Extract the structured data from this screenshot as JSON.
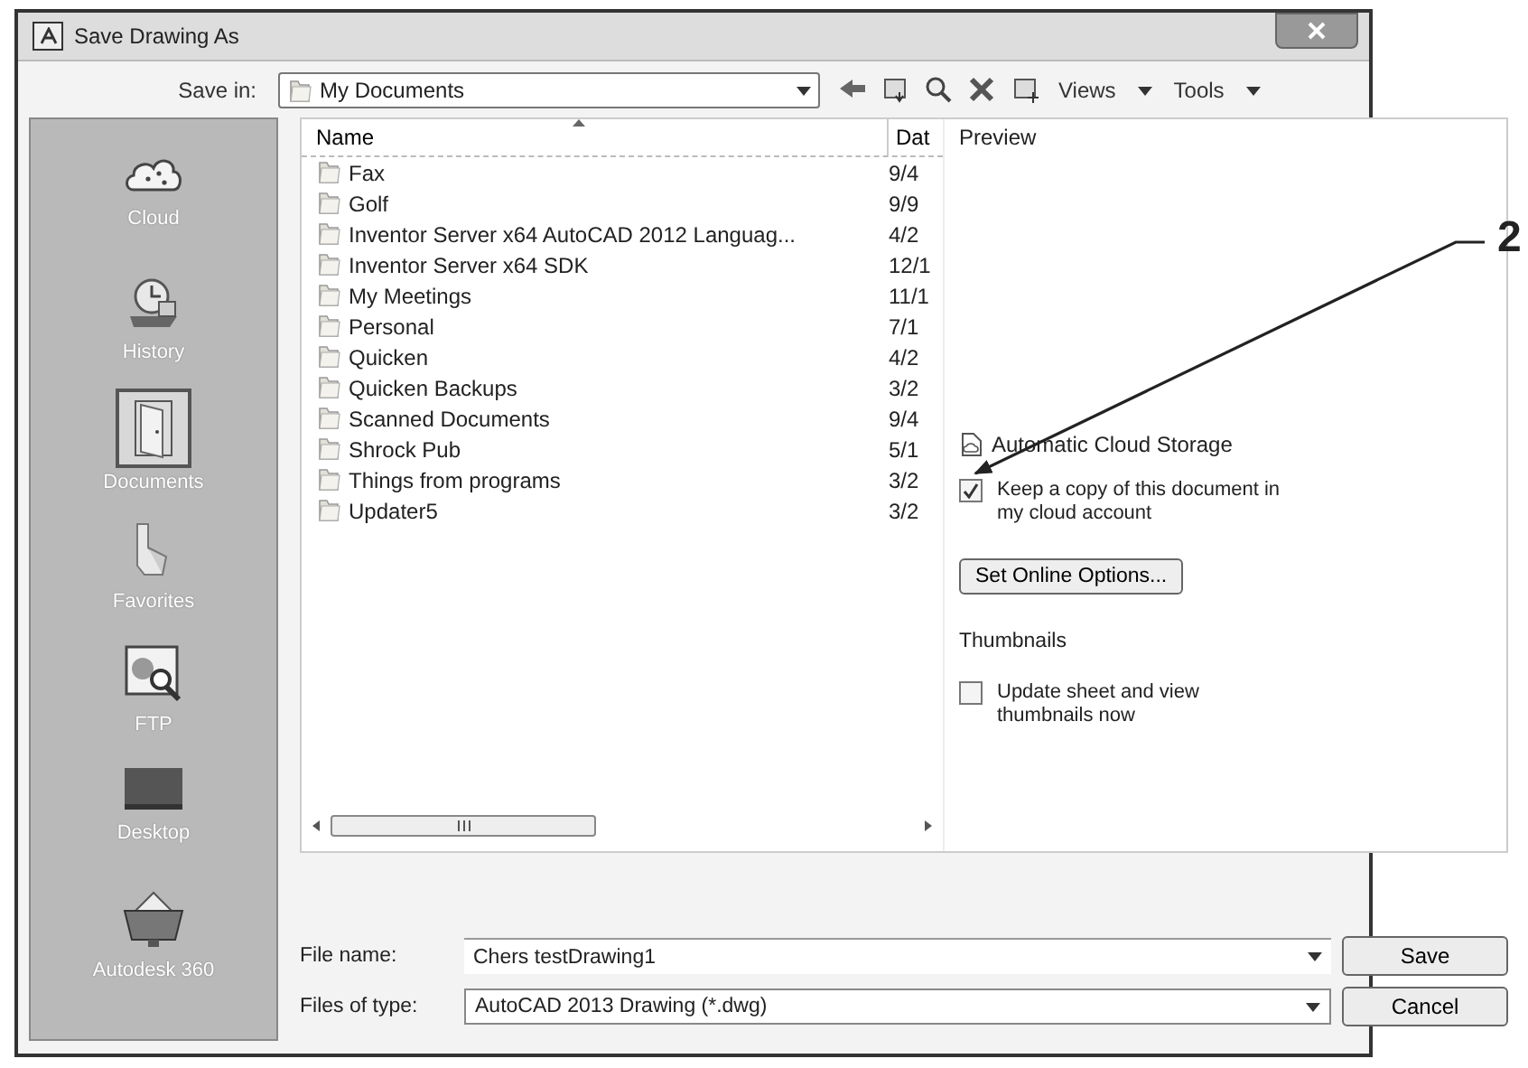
{
  "window": {
    "title": "Save Drawing As"
  },
  "toolbar": {
    "save_in_label": "Save in:",
    "save_in_value": "My Documents",
    "menus": [
      "Views",
      "Tools"
    ]
  },
  "places": [
    {
      "label": "Cloud",
      "kind": "cloud",
      "selected": false
    },
    {
      "label": "History",
      "kind": "history",
      "selected": false
    },
    {
      "label": "Documents",
      "kind": "documents",
      "selected": true
    },
    {
      "label": "Favorites",
      "kind": "favorites",
      "selected": false
    },
    {
      "label": "FTP",
      "kind": "ftp",
      "selected": false
    },
    {
      "label": "Desktop",
      "kind": "desktop",
      "selected": false
    },
    {
      "label": "Autodesk 360",
      "kind": "cloud360",
      "selected": false
    }
  ],
  "file_list": {
    "columns": [
      "Name",
      "Dat"
    ],
    "rows": [
      {
        "name": "Fax",
        "date": "9/4"
      },
      {
        "name": "Golf",
        "date": "9/9"
      },
      {
        "name": "Inventor Server x64 AutoCAD 2012 Languag...",
        "date": "4/2"
      },
      {
        "name": "Inventor Server x64 SDK",
        "date": "12/1"
      },
      {
        "name": "My Meetings",
        "date": "11/1"
      },
      {
        "name": "Personal",
        "date": "7/1"
      },
      {
        "name": "Quicken",
        "date": "4/2"
      },
      {
        "name": "Quicken Backups",
        "date": "3/2"
      },
      {
        "name": "Scanned Documents",
        "date": "9/4"
      },
      {
        "name": "Shrock Pub",
        "date": "5/1"
      },
      {
        "name": "Things from programs",
        "date": "3/2"
      },
      {
        "name": "Updater5",
        "date": "3/2"
      }
    ]
  },
  "preview": {
    "title": "Preview",
    "cloud_heading": "Automatic Cloud Storage",
    "cloud_option": {
      "label": "Keep a copy of this document in my cloud account",
      "checked": true
    },
    "online_button": "Set Online Options...",
    "thumbnails_heading": "Thumbnails",
    "thumbnail_option": {
      "label": "Update sheet and view thumbnails now",
      "checked": false
    }
  },
  "file_name": {
    "label": "File name:",
    "value": "Chers testDrawing1"
  },
  "file_type": {
    "label": "Files of type:",
    "value": "AutoCAD 2013 Drawing (*.dwg)"
  },
  "buttons": [
    "Save",
    "Cancel"
  ],
  "callout": {
    "label": "2"
  }
}
